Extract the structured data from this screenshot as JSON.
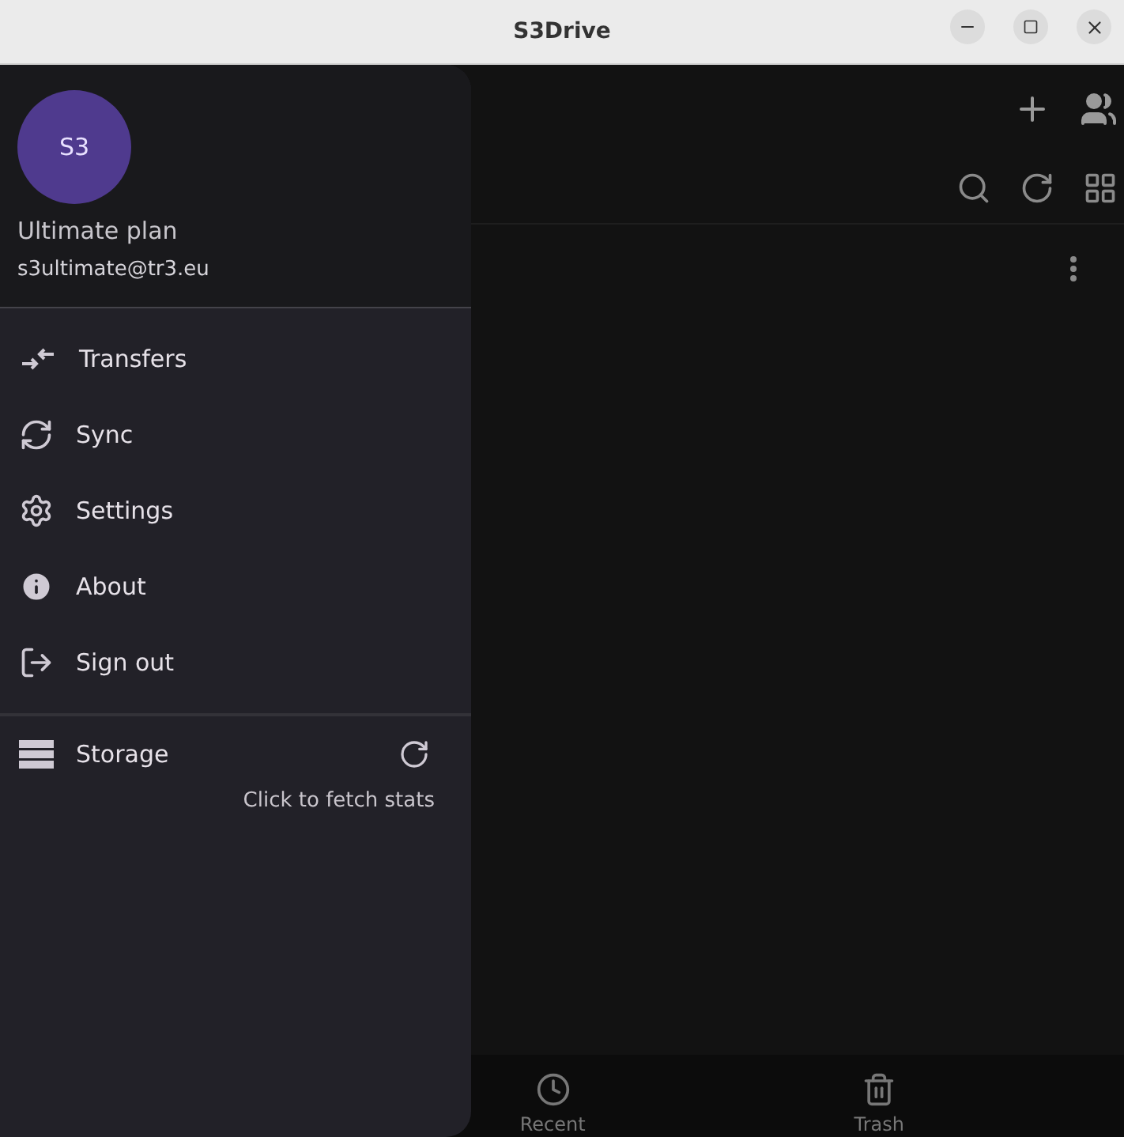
{
  "window": {
    "title": "S3Drive"
  },
  "drawer": {
    "avatar": "S3",
    "plan": "Ultimate plan",
    "email": "s3ultimate@tr3.eu",
    "items": [
      {
        "label": "Transfers"
      },
      {
        "label": "Sync"
      },
      {
        "label": "Settings"
      },
      {
        "label": "About"
      },
      {
        "label": "Sign out"
      }
    ],
    "storage": {
      "label": "Storage",
      "hint": "Click to fetch stats"
    }
  },
  "bottom_nav": [
    {
      "label": "Recent"
    },
    {
      "label": "Trash"
    }
  ]
}
